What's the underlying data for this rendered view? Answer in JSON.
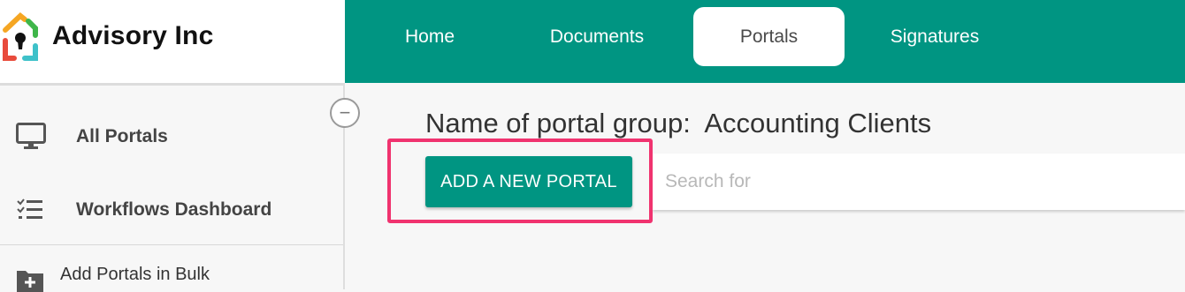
{
  "brand": {
    "name": "Advisory Inc",
    "logo_icon": "keyhole-house-logo"
  },
  "nav": {
    "items": [
      {
        "label": "Home",
        "active": false
      },
      {
        "label": "Documents",
        "active": false
      },
      {
        "label": "Portals",
        "active": true
      },
      {
        "label": "Signatures",
        "active": false
      }
    ]
  },
  "sidebar": {
    "collapse_symbol": "−",
    "items": [
      {
        "label": "All Portals",
        "icon": "monitor-icon"
      },
      {
        "label": "Workflows Dashboard",
        "icon": "checklist-icon"
      },
      {
        "label": "Add Portals in Bulk",
        "icon": "folder-plus-icon"
      }
    ]
  },
  "main": {
    "group_title": "Name of portal group:  Accounting Clients",
    "add_button_label": "ADD A NEW PORTAL",
    "search_placeholder": "Search for"
  },
  "colors": {
    "accent": "#009582",
    "highlight": "#f0336f"
  }
}
